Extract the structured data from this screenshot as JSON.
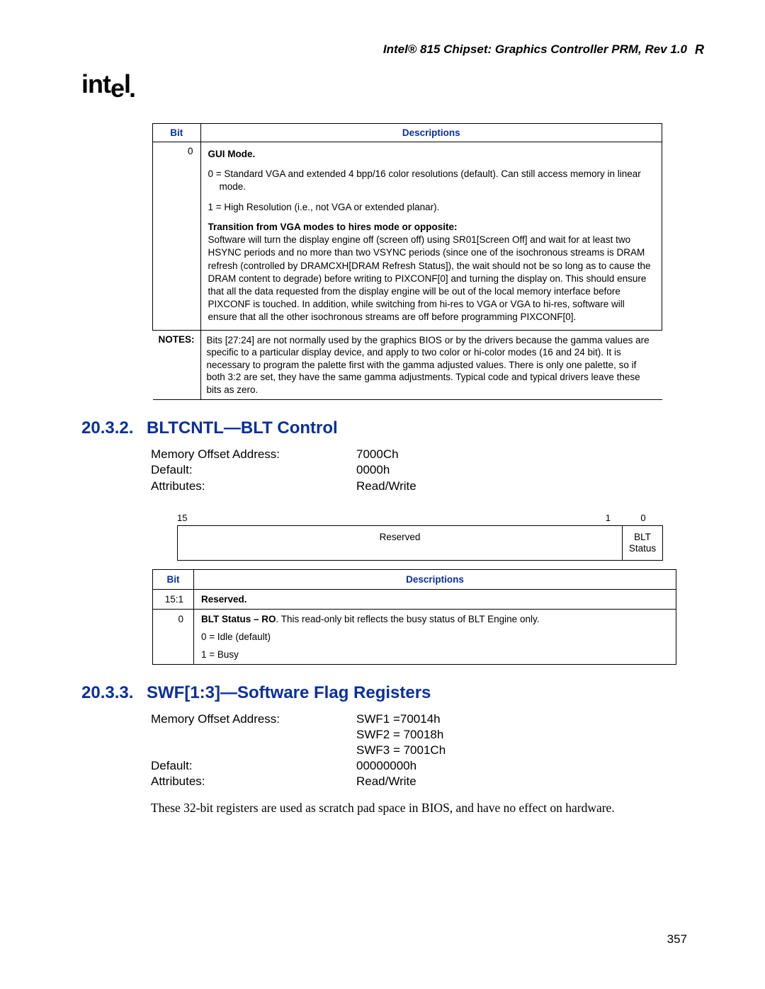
{
  "header": {
    "title": "Intel® 815 Chipset: Graphics Controller PRM, Rev 1.0"
  },
  "logo": {
    "text_pre": "int",
    "text_e": "e",
    "text_post": "l",
    "dot": "."
  },
  "table1": {
    "headers": {
      "bit": "Bit",
      "desc": "Descriptions"
    },
    "row_bit": "0",
    "row_desc": {
      "title": "GUI Mode.",
      "line0a": "0 = Standard VGA and extended 4 bpp/16 color resolutions (default). Can still access memory in linear",
      "line0b": "mode.",
      "line1": "1 = High Resolution (i.e., not VGA or extended planar).",
      "trans_title": "Transition from VGA modes to hires mode or opposite:",
      "trans_body": "Software will turn the display engine off (screen off) using SR01[Screen Off] and wait for at least two HSYNC periods and no more than two VSYNC periods (since one of the isochronous streams is DRAM refresh (controlled by DRAMCXH[DRAM Refresh Status]), the wait should not be so long as to cause the DRAM content to degrade) before writing to PIXCONF[0] and turning the display on. This should ensure that all the data requested from the display engine will be out of the local memory interface before PIXCONF is touched. In addition, while switching from hi-res to VGA or VGA to hi-res, software will ensure that all the other isochronous streams are off before programming PIXCONF[0]."
    },
    "notes_label": "NOTES:",
    "notes_text": "Bits [27:24] are not normally used by the graphics BIOS or by the drivers because the gamma values are specific to a particular display device, and apply to two color or hi-color modes (16 and 24 bit). It is necessary to program the palette first with the gamma adjusted values. There is only one palette, so if both 3:2 are set, they have the same gamma adjustments. Typical code and typical drivers leave these bits as zero."
  },
  "section1": {
    "num": "20.3.2.",
    "title": "BLTCNTL—BLT Control",
    "attrs": {
      "mem_label": "Memory Offset Address:",
      "mem_value": "7000Ch",
      "def_label": "Default:",
      "def_value": "0000h",
      "att_label": "Attributes:",
      "att_value": "Read/Write"
    },
    "bitmap": {
      "n15": "15",
      "n1": "1",
      "n0": "0",
      "reserved": "Reserved",
      "blt": "BLT Status"
    },
    "table": {
      "headers": {
        "bit": "Bit",
        "desc": "Descriptions"
      },
      "r1_bit": "15:1",
      "r1_desc": "Reserved.",
      "r2_bit": "0",
      "r2_line1a": "BLT Status – RO",
      "r2_line1b": ". This read-only bit reflects the busy status of BLT Engine only.",
      "r2_line2": "0 = Idle (default)",
      "r2_line3": "1 = Busy"
    }
  },
  "section2": {
    "num": "20.3.3.",
    "title": "SWF[1:3]—Software Flag Registers",
    "attrs": {
      "mem_label": "Memory Offset Address:",
      "mem_v1": "SWF1 =70014h",
      "mem_v2": "SWF2 = 70018h",
      "mem_v3": "SWF3 = 7001Ch",
      "def_label": "Default:",
      "def_value": "00000000h",
      "att_label": "Attributes:",
      "att_value": "Read/Write"
    },
    "body": "These 32-bit registers are used as scratch pad space in BIOS, and have no effect on hardware."
  },
  "page_number": "357",
  "r_marker": "R"
}
